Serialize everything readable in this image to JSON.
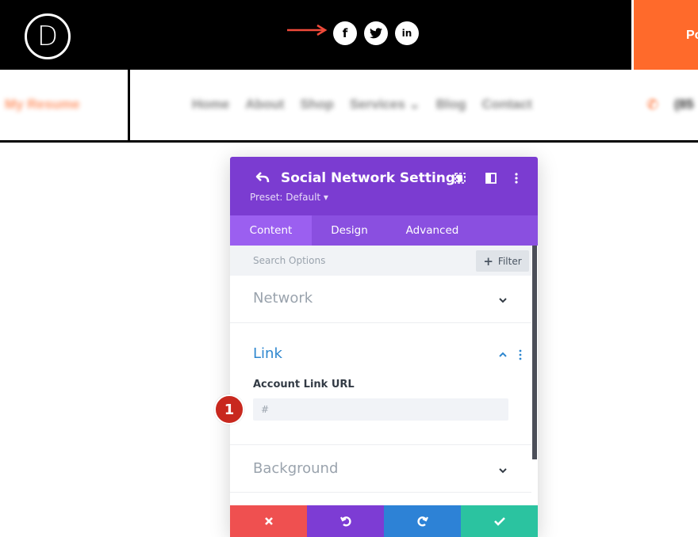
{
  "header": {
    "logo_letter": "D",
    "cta_label": "Po",
    "social_icons": [
      "facebook-icon",
      "twitter-icon",
      "linkedin-icon"
    ]
  },
  "nav": {
    "brand": "My Resume",
    "items": [
      "Home",
      "About",
      "Shop",
      "Services ⌄",
      "Blog",
      "Contact"
    ],
    "phone_partial": "(85"
  },
  "modal": {
    "title": "Social Network Settings",
    "preset": "Preset: Default ▾",
    "tabs": [
      "Content",
      "Design",
      "Advanced"
    ],
    "active_tab": "Content",
    "search_placeholder": "Search Options",
    "filter_label": "Filter",
    "sections": {
      "network": "Network",
      "link": "Link",
      "background": "Background"
    },
    "field": {
      "label": "Account Link URL",
      "placeholder": "#"
    }
  },
  "callout": {
    "number": "1"
  },
  "colors": {
    "header_purple": "#7b3cd1",
    "tab_purple": "#8a4fe0",
    "orange": "#ff6a2b",
    "link_blue": "#2e87cf",
    "discard": "#ef5050",
    "undo": "#7d3cd4",
    "redo": "#2d82d6",
    "save": "#2bc3a0",
    "badge_red": "#c8281e"
  }
}
